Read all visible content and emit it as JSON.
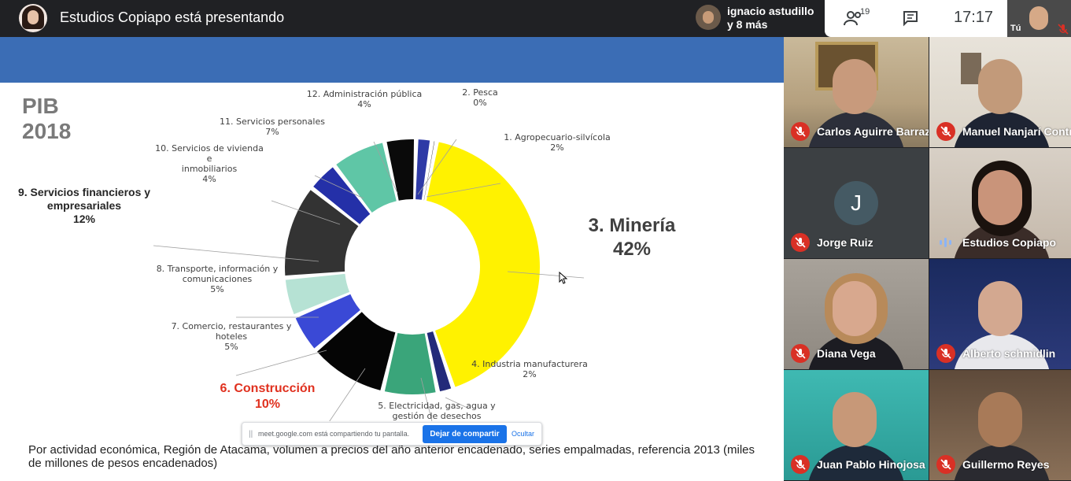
{
  "topbar": {
    "presenter_title": "Estudios Copiapo está presentando",
    "others_line1": "ignacio astudillo",
    "others_line2": "y 8 más",
    "people_count": "19",
    "clock": "17:17",
    "self_label": "Tú"
  },
  "slide": {
    "title_line1": "PIB",
    "title_line2": "2018",
    "caption": "Por actividad económica, Región de Atacama, volumen a precios del año anterior encadenado, series empalmadas, referencia 2013 (miles de millones de pesos encadenados)"
  },
  "chart_data": {
    "type": "pie",
    "title": "PIB 2018",
    "slices": [
      {
        "label": "1. Agropecuario-silvícola",
        "value": 2,
        "pct": "2%",
        "color": "#2e3aa6"
      },
      {
        "label": "2. Pesca",
        "value": 0,
        "pct": "0%",
        "color": "#1a1a1a"
      },
      {
        "label": "3. Minería",
        "value": 42,
        "pct": "42%",
        "color": "#fff200"
      },
      {
        "label": "4. Industria manufacturera",
        "value": 2,
        "pct": "2%",
        "color": "#232a7a"
      },
      {
        "label": "5. Electricidad, gas, agua y gestión de desechos",
        "value": 7,
        "pct": "",
        "color": "#3aa57a"
      },
      {
        "label": "6. Construcción",
        "value": 10,
        "pct": "10%",
        "color": "#050505"
      },
      {
        "label": "7. Comercio, restaurantes y hoteles",
        "value": 5,
        "pct": "5%",
        "color": "#3a49d6"
      },
      {
        "label": "8. Transporte, información y comunicaciones",
        "value": 5,
        "pct": "5%",
        "color": "#b6e2d4"
      },
      {
        "label": "9. Servicios financieros y empresariales",
        "value": 12,
        "pct": "12%",
        "color": "#333333"
      },
      {
        "label": "10. Servicios de vivienda e inmobiliarios",
        "value": 4,
        "pct": "4%",
        "color": "#2430a8"
      },
      {
        "label": "11. Servicios personales",
        "value": 7,
        "pct": "7%",
        "color": "#5fc6a6"
      },
      {
        "label": "12. Administración pública",
        "value": 4,
        "pct": "4%",
        "color": "#0a0a0a"
      }
    ],
    "labels": {
      "l1": {
        "name": "1. Agropecuario-silvícola",
        "pct": "2%"
      },
      "l2": {
        "name": "2. Pesca",
        "pct": "0%"
      },
      "l3": {
        "name": "3. Minería",
        "pct": "42%"
      },
      "l4": {
        "name": "4. Industria manufacturera",
        "pct": "2%"
      },
      "l5": {
        "name1": "5. Electricidad, gas, agua y",
        "name2": "gestión de desechos"
      },
      "l6": {
        "name": "6. Construcción",
        "pct": "10%"
      },
      "l7": {
        "name1": "7. Comercio, restaurantes y",
        "name2": "hoteles",
        "pct": "5%"
      },
      "l8": {
        "name1": "8. Transporte, información y",
        "name2": "comunicaciones",
        "pct": "5%"
      },
      "l9": {
        "name1": "9. Servicios financieros y",
        "name2": "empresariales",
        "pct": "12%"
      },
      "l10": {
        "name1": "10. Servicios de vivienda e",
        "name2": "inmobiliarios",
        "pct": "4%"
      },
      "l11": {
        "name": "11. Servicios personales",
        "pct": "7%"
      },
      "l12": {
        "name": "12. Administración pública",
        "pct": "4%"
      }
    }
  },
  "share_bar": {
    "text": "meet.google.com está compartiendo tu pantalla.",
    "stop_label": "Dejar de compartir",
    "hide_label": "Ocultar"
  },
  "participants": [
    {
      "name": "Carlos Aguirre Barraza",
      "muted": true
    },
    {
      "name": "Manuel Nanjarí Contr...",
      "muted": true
    },
    {
      "name": "Jorge Ruiz",
      "muted": true,
      "initial": "J"
    },
    {
      "name": "Estudios Copiapo",
      "muted": false
    },
    {
      "name": "Diana Vega",
      "muted": true
    },
    {
      "name": "Alberto schmidlin",
      "muted": true
    },
    {
      "name": "Juan Pablo Hinojosa",
      "muted": true
    },
    {
      "name": "Guillermo Reyes",
      "muted": true
    }
  ]
}
